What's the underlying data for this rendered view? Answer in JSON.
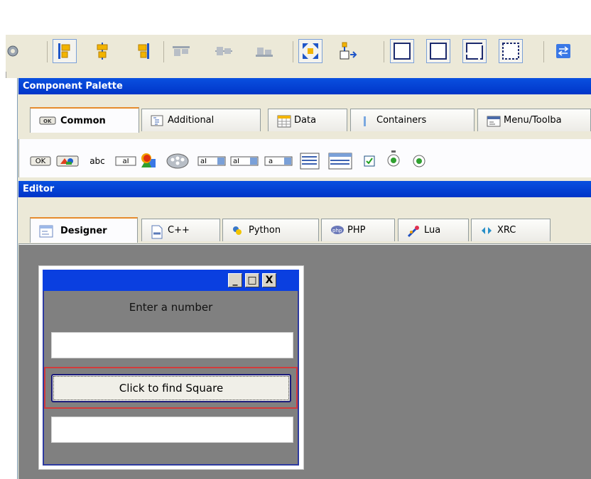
{
  "palette_header": "Component Palette",
  "editor_header": "Editor",
  "palette_tabs": [
    {
      "label": "Common",
      "icon": "ok-button-icon"
    },
    {
      "label": "Additional",
      "icon": "tree-list-icon"
    },
    {
      "label": "Data",
      "icon": "grid-icon"
    },
    {
      "label": "Containers",
      "icon": "container-icon"
    },
    {
      "label": "Menu/Toolba",
      "icon": "menu-toolbar-icon"
    }
  ],
  "editor_tabs": [
    {
      "label": "Designer",
      "icon": "designer-icon"
    },
    {
      "label": "C++",
      "icon": "cpp-file-icon"
    },
    {
      "label": "Python",
      "icon": "python-icon"
    },
    {
      "label": "PHP",
      "icon": "php-icon"
    },
    {
      "label": "Lua",
      "icon": "lua-icon"
    },
    {
      "label": "XRC",
      "icon": "xrc-icon"
    }
  ],
  "palette_items": {
    "button": "OK",
    "static_text": "abc",
    "text_ctrl": "aI",
    "combo1": "aI",
    "combo2": "aI",
    "choice": "a"
  },
  "mini_frame": {
    "controls": [
      "_",
      "□",
      "X"
    ],
    "label": "Enter a number",
    "button": "Click to find Square",
    "input1_value": "",
    "input2_value": ""
  },
  "colors": {
    "header_blue": "#0a46dc",
    "active_tab_accent": "#e68b2c",
    "sizer_red": "#d23b3b"
  }
}
